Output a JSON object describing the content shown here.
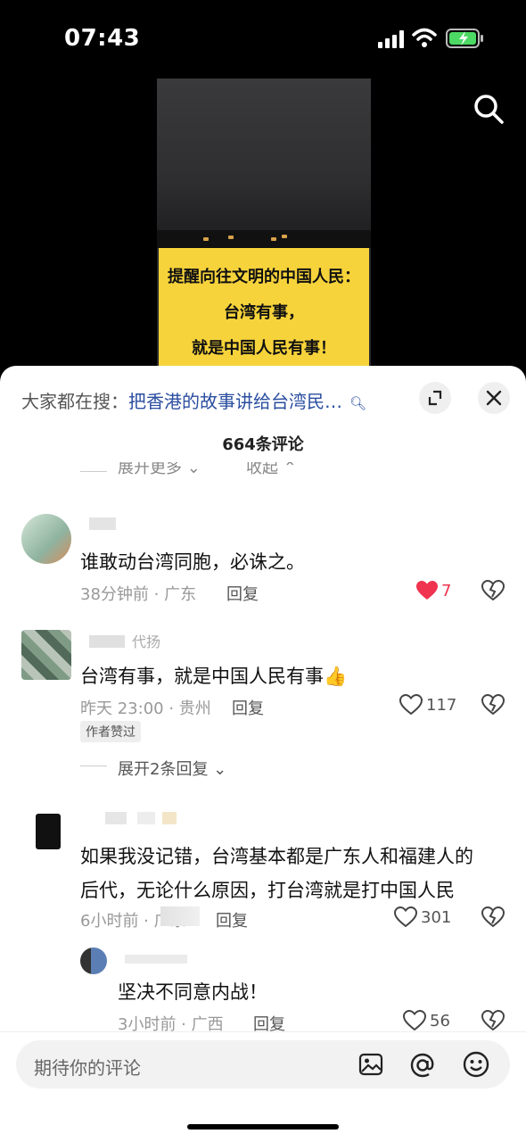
{
  "status": {
    "time": "07:43"
  },
  "video": {
    "caption": [
      "提醒向往文明的中国人民：",
      "台湾有事，",
      "就是中国人民有事！"
    ]
  },
  "sheet": {
    "hot_prefix": "大家都在搜：",
    "hot_query": "把香港的故事讲给台湾民…",
    "comment_count": "664条评论",
    "prev_expand": "展开更多",
    "prev_collapse": "收起"
  },
  "comments": [
    {
      "text": "谁敢动台湾同胞，必诛之。",
      "meta": "38分钟前 · 广东",
      "reply": "回复",
      "likes": "7",
      "liked": true
    },
    {
      "name_fragment": "代扬",
      "text": "台湾有事，就是中国人民有事👍",
      "meta": "昨天 23:00 · 贵州",
      "reply": "回复",
      "likes": "117",
      "badge": "作者赞过",
      "expand": "展开2条回复"
    },
    {
      "text_line1": "如果我没记错，台湾基本都是广东人和福建人的",
      "text_line2": "后代，无论什么原因，打台湾就是打中国人民",
      "meta": "6小时前 · 广东",
      "reply": "回复",
      "likes": "301"
    },
    {
      "text": "坚决不同意内战！",
      "meta": "3小时前 · 广西",
      "reply": "回复",
      "likes": "56"
    }
  ],
  "input": {
    "placeholder": "期待你的评论"
  },
  "colors": {
    "liked": "#f0334f",
    "caption_bg": "#f7d33b",
    "link": "#2b4ea0"
  }
}
